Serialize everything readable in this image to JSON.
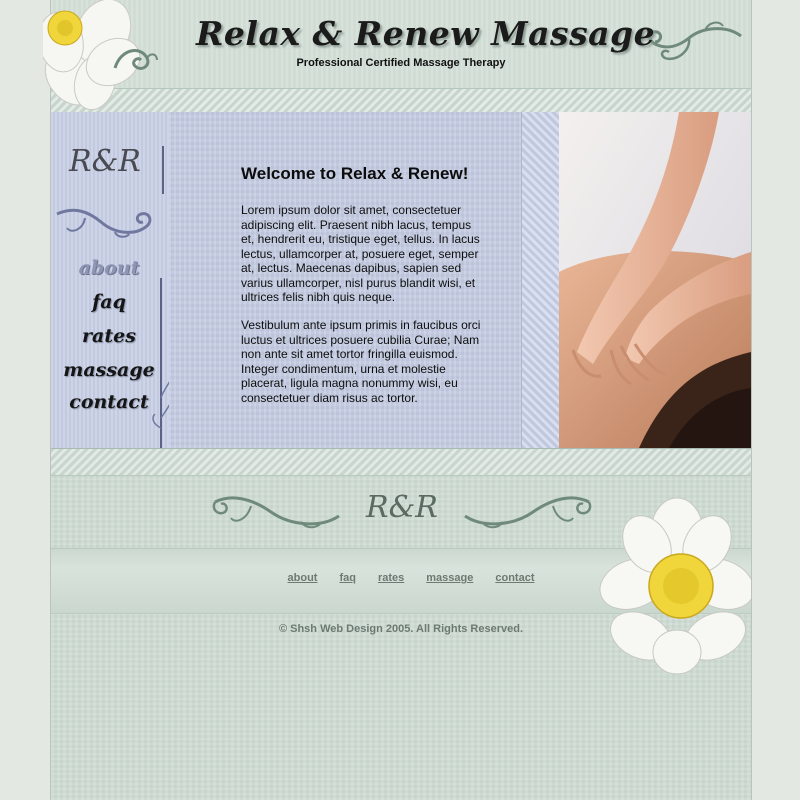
{
  "header": {
    "title": "Relax & Renew Massage",
    "tagline": "Professional Certified Massage Therapy"
  },
  "sidebar": {
    "monogram": "R&R",
    "nav": [
      {
        "label": "about",
        "active": true
      },
      {
        "label": "faq",
        "active": false
      },
      {
        "label": "rates",
        "active": false
      },
      {
        "label": "massage",
        "active": false
      },
      {
        "label": "contact",
        "active": false
      }
    ]
  },
  "content": {
    "heading": "Welcome to Relax & Renew!",
    "paragraph1": "Lorem ipsum dolor sit amet, consectetuer adipiscing elit. Praesent nibh lacus, tempus et, hendrerit eu, tristique eget, tellus. In lacus lectus, ullamcorper at, posuere eget, semper at, lectus. Maecenas dapibus, sapien sed varius ullamcorper, nisl purus blandit wisi, et ultrices felis nibh quis neque.",
    "paragraph2": "Vestibulum ante ipsum primis in faucibus orci luctus et ultrices posuere cubilia Curae; Nam non ante sit amet tortor fringilla euismod. Integer condimentum, urna et molestie placerat, ligula magna nonummy wisi, eu consectetuer diam risus ac tortor."
  },
  "footer": {
    "monogram": "R&R",
    "links": [
      "about",
      "faq",
      "rates",
      "massage",
      "contact"
    ],
    "copyright": "© Shsh Web Design 2005.  All Rights Reserved."
  },
  "icons": {
    "header_flower": "water-lily-icon",
    "footer_flower": "water-lily-icon",
    "swirl": "scroll-ornament-icon"
  },
  "colors": {
    "towel_green": "#cfdcd4",
    "towel_blue": "#c5cde3",
    "nav_active": "#8d94b4",
    "footer_link": "#6d7a72"
  }
}
